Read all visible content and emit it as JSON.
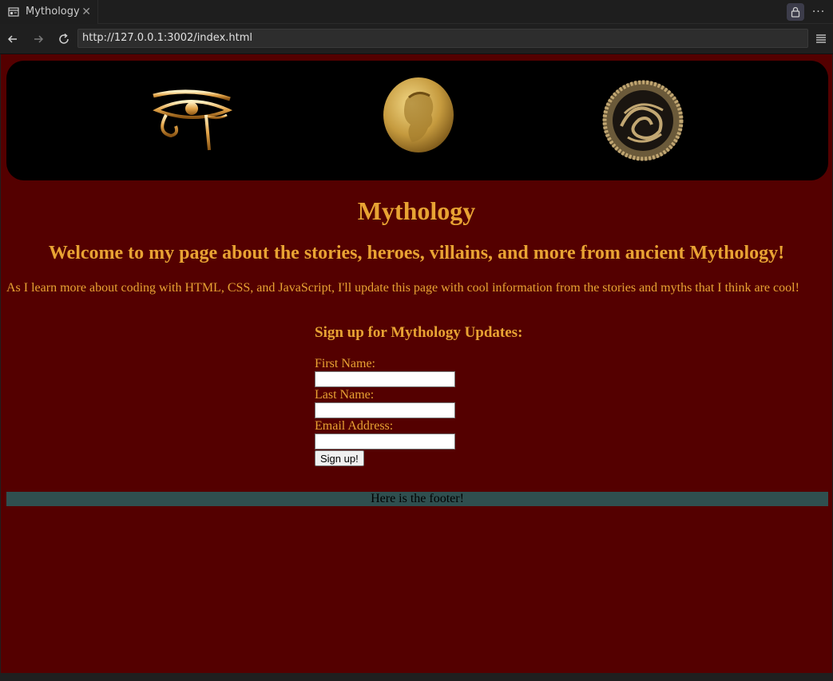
{
  "browser": {
    "tab_title": "Mythology",
    "url": "http://127.0.0.1:3002/index.html"
  },
  "page": {
    "title": "Mythology",
    "welcome": "Welcome to my page about the stories, heroes, villains, and more from ancient Mythology!",
    "intro": "As I learn more about coding with HTML, CSS, and JavaScript, I'll update this page with cool information from the stories and myths that I think are cool!",
    "signup": {
      "heading": "Sign up for Mythology Updates:",
      "first_name_label": "First Name:",
      "first_name_value": "",
      "last_name_label": "Last Name:",
      "last_name_value": "",
      "email_label": "Email Address:",
      "email_value": "",
      "submit_label": "Sign up!"
    },
    "footer": "Here is the footer!"
  },
  "colors": {
    "page_bg": "#540000",
    "text_gold": "#e8a333",
    "footer_bg": "#2f4f4f",
    "banner_bg": "#000000"
  },
  "icons": [
    "eye-of-horus-image",
    "greek-gold-coin-image",
    "celtic-knot-medallion-image",
    "lock-icon",
    "more-icon",
    "back-icon",
    "forward-icon",
    "reload-icon",
    "menu-icon",
    "tab-page-icon",
    "close-icon"
  ]
}
